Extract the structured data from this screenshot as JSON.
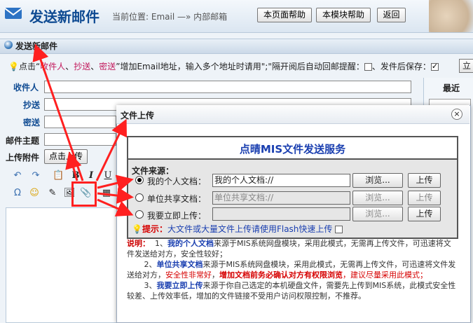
{
  "header": {
    "title": "发送新邮件",
    "location": "当前位置: Email —» 内部邮箱",
    "buttons": [
      "本页面帮助",
      "本模块帮助",
      "返回"
    ]
  },
  "panel": {
    "title": "发送新邮件",
    "notice_prefix": "点击“",
    "notice_links": [
      "收件人",
      "抄送",
      "密送"
    ],
    "notice_sep": "、",
    "notice_suffix": "”增加Email地址，输入多个地址时请用\";\"隔开",
    "read_receipt_label": "阅后自动回邮提醒：",
    "save_after_send_label": "、发件后保存：",
    "read_receipt_checked": false,
    "save_after_send_checked": true,
    "extra_button": "立"
  },
  "fields": {
    "to_label": "收件人",
    "cc_label": "抄送",
    "bcc_label": "密送",
    "subject_label": "邮件主题",
    "attach_label": "上传附件",
    "attach_button": "点击上传"
  },
  "recent": {
    "title": "最近"
  },
  "toolbar": {
    "icons": [
      "undo-icon",
      "redo-icon",
      "paste-icon",
      "bold-icon",
      "italic-icon",
      "underline-icon",
      "special-char-icon",
      "emoji-icon",
      "edit-icon",
      "image-icon",
      "attachment-icon",
      "table-icon"
    ]
  },
  "dialog": {
    "title": "文件上传",
    "close": "×",
    "service_title": "点晴MIS文件发送服务",
    "source_label": "文件来源：",
    "rows": [
      {
        "label": "我的个人文档：",
        "value": "我的个人文档://",
        "browse": "浏览...",
        "upload": "上传",
        "selected": true,
        "disabled": false
      },
      {
        "label": "单位共享文档：",
        "value": "单位共享文档://",
        "browse": "浏览...",
        "upload": "上传",
        "selected": false,
        "disabled": true
      },
      {
        "label": "我要立即上传：",
        "value": "",
        "browse": "浏览...",
        "upload": "上传",
        "selected": false,
        "disabled": true
      }
    ],
    "tip_label": "提示：",
    "tip_text": "大文件或大量文件上传请使用Flash快速上传",
    "flash_checked": false
  },
  "notes": {
    "title": "说明：",
    "n1_prefix": "1、",
    "n1_bold": "我的个人文档",
    "n1_text": "来源于MIS系统网盘模块，采用此模式，无需再上传文件，可迅速将文件发送给对方，安全性较好；",
    "n2_prefix": "2、",
    "n2_bold": "单位共享文档",
    "n2_text": "来源于MIS系统网盘模块，采用此模式，无需再上传文件，可迅速将文件发送给对方，",
    "n2_red1": "安全性非常好",
    "n2_sep": "，",
    "n2_red2": "增加文档前务必确认对方有权限浏览",
    "n2_red3": "，建议尽量采用此模式；",
    "n3_prefix": "3、",
    "n3_bold": "我要立即上传",
    "n3_text": "来源于你自己选定的本机硬盘文件，需要先上传到MIS系统，此模式安全性较差、上传效率低，增加的文件链接不受用户访问权限控制，不推荐。"
  },
  "colors": {
    "accent": "#0e4a92",
    "annotation_arrow": "#ff2020",
    "service_title": "#1a3fb0"
  }
}
